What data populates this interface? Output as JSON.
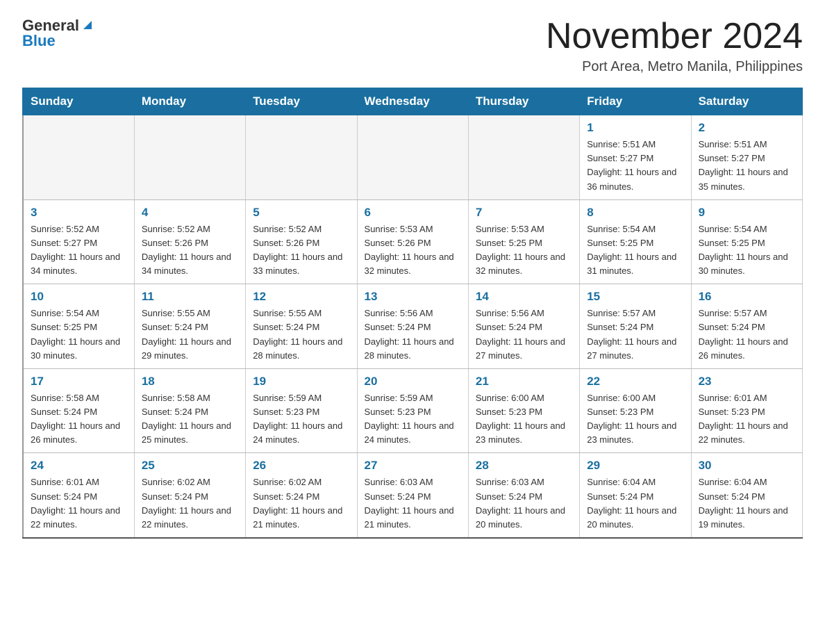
{
  "header": {
    "logo_general": "General",
    "logo_blue": "Blue",
    "month_title": "November 2024",
    "location": "Port Area, Metro Manila, Philippines"
  },
  "days_of_week": [
    "Sunday",
    "Monday",
    "Tuesday",
    "Wednesday",
    "Thursday",
    "Friday",
    "Saturday"
  ],
  "weeks": [
    [
      {
        "day": "",
        "info": ""
      },
      {
        "day": "",
        "info": ""
      },
      {
        "day": "",
        "info": ""
      },
      {
        "day": "",
        "info": ""
      },
      {
        "day": "",
        "info": ""
      },
      {
        "day": "1",
        "info": "Sunrise: 5:51 AM\nSunset: 5:27 PM\nDaylight: 11 hours and 36 minutes."
      },
      {
        "day": "2",
        "info": "Sunrise: 5:51 AM\nSunset: 5:27 PM\nDaylight: 11 hours and 35 minutes."
      }
    ],
    [
      {
        "day": "3",
        "info": "Sunrise: 5:52 AM\nSunset: 5:27 PM\nDaylight: 11 hours and 34 minutes."
      },
      {
        "day": "4",
        "info": "Sunrise: 5:52 AM\nSunset: 5:26 PM\nDaylight: 11 hours and 34 minutes."
      },
      {
        "day": "5",
        "info": "Sunrise: 5:52 AM\nSunset: 5:26 PM\nDaylight: 11 hours and 33 minutes."
      },
      {
        "day": "6",
        "info": "Sunrise: 5:53 AM\nSunset: 5:26 PM\nDaylight: 11 hours and 32 minutes."
      },
      {
        "day": "7",
        "info": "Sunrise: 5:53 AM\nSunset: 5:25 PM\nDaylight: 11 hours and 32 minutes."
      },
      {
        "day": "8",
        "info": "Sunrise: 5:54 AM\nSunset: 5:25 PM\nDaylight: 11 hours and 31 minutes."
      },
      {
        "day": "9",
        "info": "Sunrise: 5:54 AM\nSunset: 5:25 PM\nDaylight: 11 hours and 30 minutes."
      }
    ],
    [
      {
        "day": "10",
        "info": "Sunrise: 5:54 AM\nSunset: 5:25 PM\nDaylight: 11 hours and 30 minutes."
      },
      {
        "day": "11",
        "info": "Sunrise: 5:55 AM\nSunset: 5:24 PM\nDaylight: 11 hours and 29 minutes."
      },
      {
        "day": "12",
        "info": "Sunrise: 5:55 AM\nSunset: 5:24 PM\nDaylight: 11 hours and 28 minutes."
      },
      {
        "day": "13",
        "info": "Sunrise: 5:56 AM\nSunset: 5:24 PM\nDaylight: 11 hours and 28 minutes."
      },
      {
        "day": "14",
        "info": "Sunrise: 5:56 AM\nSunset: 5:24 PM\nDaylight: 11 hours and 27 minutes."
      },
      {
        "day": "15",
        "info": "Sunrise: 5:57 AM\nSunset: 5:24 PM\nDaylight: 11 hours and 27 minutes."
      },
      {
        "day": "16",
        "info": "Sunrise: 5:57 AM\nSunset: 5:24 PM\nDaylight: 11 hours and 26 minutes."
      }
    ],
    [
      {
        "day": "17",
        "info": "Sunrise: 5:58 AM\nSunset: 5:24 PM\nDaylight: 11 hours and 26 minutes."
      },
      {
        "day": "18",
        "info": "Sunrise: 5:58 AM\nSunset: 5:24 PM\nDaylight: 11 hours and 25 minutes."
      },
      {
        "day": "19",
        "info": "Sunrise: 5:59 AM\nSunset: 5:23 PM\nDaylight: 11 hours and 24 minutes."
      },
      {
        "day": "20",
        "info": "Sunrise: 5:59 AM\nSunset: 5:23 PM\nDaylight: 11 hours and 24 minutes."
      },
      {
        "day": "21",
        "info": "Sunrise: 6:00 AM\nSunset: 5:23 PM\nDaylight: 11 hours and 23 minutes."
      },
      {
        "day": "22",
        "info": "Sunrise: 6:00 AM\nSunset: 5:23 PM\nDaylight: 11 hours and 23 minutes."
      },
      {
        "day": "23",
        "info": "Sunrise: 6:01 AM\nSunset: 5:23 PM\nDaylight: 11 hours and 22 minutes."
      }
    ],
    [
      {
        "day": "24",
        "info": "Sunrise: 6:01 AM\nSunset: 5:24 PM\nDaylight: 11 hours and 22 minutes."
      },
      {
        "day": "25",
        "info": "Sunrise: 6:02 AM\nSunset: 5:24 PM\nDaylight: 11 hours and 22 minutes."
      },
      {
        "day": "26",
        "info": "Sunrise: 6:02 AM\nSunset: 5:24 PM\nDaylight: 11 hours and 21 minutes."
      },
      {
        "day": "27",
        "info": "Sunrise: 6:03 AM\nSunset: 5:24 PM\nDaylight: 11 hours and 21 minutes."
      },
      {
        "day": "28",
        "info": "Sunrise: 6:03 AM\nSunset: 5:24 PM\nDaylight: 11 hours and 20 minutes."
      },
      {
        "day": "29",
        "info": "Sunrise: 6:04 AM\nSunset: 5:24 PM\nDaylight: 11 hours and 20 minutes."
      },
      {
        "day": "30",
        "info": "Sunrise: 6:04 AM\nSunset: 5:24 PM\nDaylight: 11 hours and 19 minutes."
      }
    ]
  ]
}
